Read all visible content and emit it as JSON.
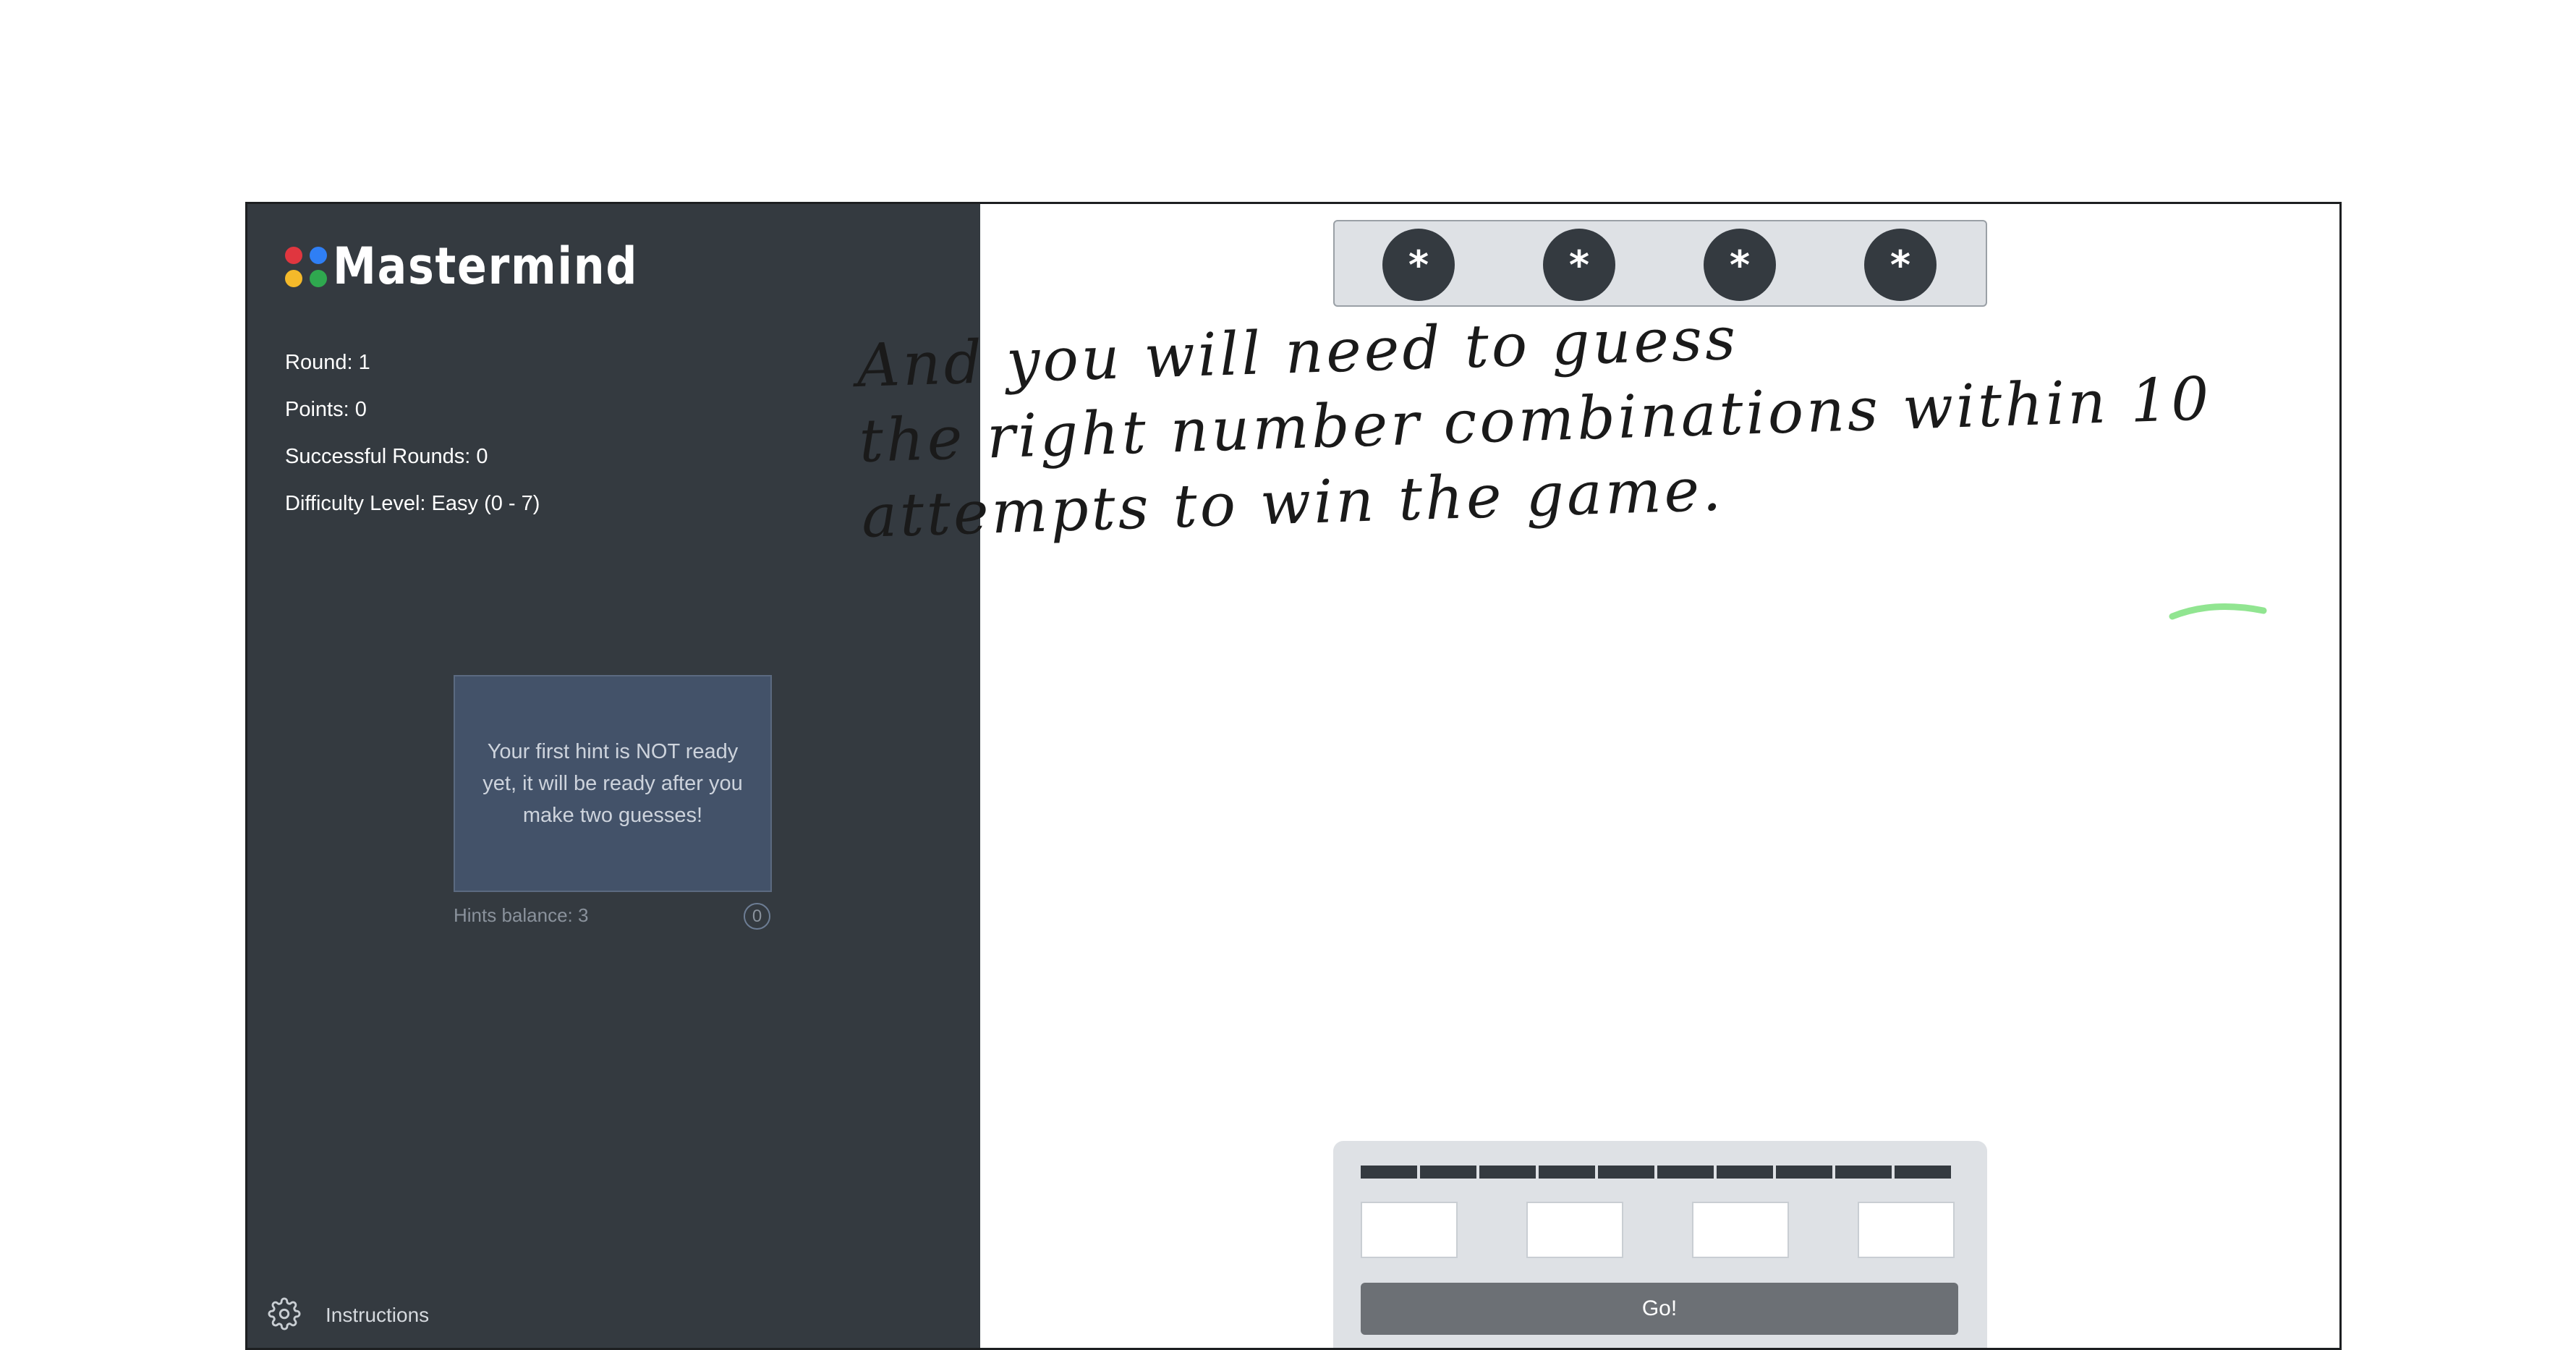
{
  "app": {
    "title": "Mastermind"
  },
  "colors": {
    "dot_red": "#e0363f",
    "dot_blue": "#2f7ff5",
    "dot_yellow": "#f4b92a",
    "dot_green": "#2fa84f",
    "highlight": "#7ee07e"
  },
  "stats": {
    "round": "Round: 1",
    "points": "Points: 0",
    "successful_rounds": "Successful Rounds: 0",
    "difficulty": "Difficulty Level: Easy (0 - 7)"
  },
  "hint": {
    "message": "Your first hint is NOT ready yet, it will be ready after you make two guesses!",
    "balance": "Hints balance: 3",
    "counter": "0"
  },
  "footer": {
    "instructions_label": "Instructions",
    "icon": "gear-icon"
  },
  "secret": {
    "pegs": [
      "*",
      "*",
      "*",
      "*"
    ]
  },
  "annotation": {
    "line1": "And you will need to guess",
    "line2": "the right number combinations within 10",
    "line3": "attempts to win the game."
  },
  "guess": {
    "attempts_total": 10,
    "inputs": [
      "",
      "",
      "",
      ""
    ],
    "go_label": "Go!"
  }
}
